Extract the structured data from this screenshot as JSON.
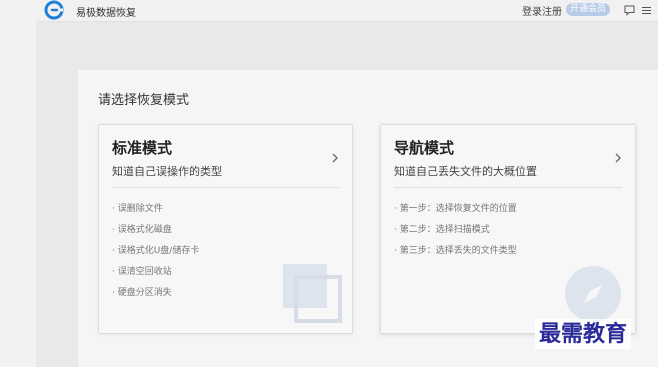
{
  "app": {
    "title": "易极数据恢复",
    "logo_icon": "app-logo-icon",
    "login_label": "登录注册",
    "vip_label": "开通会员"
  },
  "main": {
    "section_title": "请选择恢复模式",
    "cards": [
      {
        "title": "标准模式",
        "subtitle": "知道自己误操作的类型",
        "items": [
          "· 误删除文件",
          "· 误格式化磁盘",
          "· 误格式化U盘/储存卡",
          "· 误清空回收站",
          "· 硬盘分区消失"
        ],
        "decoration_icon": "disk-icon"
      },
      {
        "title": "导航模式",
        "subtitle": "知道自己丢失文件的大概位置",
        "items": [
          "· 第一步：选择恢复文件的位置",
          "· 第二步：选择扫描模式",
          "· 第三步：选择丢失的文件类型"
        ],
        "decoration_icon": "compass-icon"
      }
    ]
  },
  "watermark": "最需教育",
  "colors": {
    "accent": "#1e7fd8",
    "vip_badge": "#b7cbe8",
    "watermark": "#2a2a9a"
  }
}
